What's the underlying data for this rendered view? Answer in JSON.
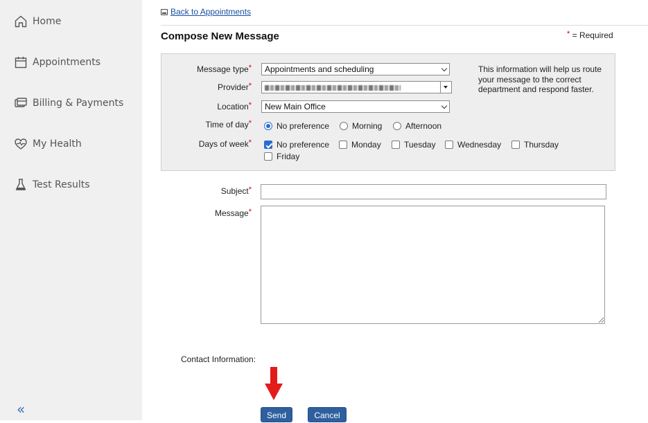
{
  "sidebar": {
    "items": [
      {
        "label": "Home",
        "icon": "home-icon"
      },
      {
        "label": "Appointments",
        "icon": "calendar-icon"
      },
      {
        "label": "Billing & Payments",
        "icon": "billing-icon"
      },
      {
        "label": "My Health",
        "icon": "heart-icon"
      },
      {
        "label": "Test Results",
        "icon": "flask-icon"
      }
    ],
    "collapse_label": "«"
  },
  "header": {
    "back_link": "Back to Appointments",
    "title": "Compose New Message",
    "required_star": "*",
    "required_text": "= Required"
  },
  "form": {
    "required_star": "*",
    "message_type": {
      "label": "Message type",
      "value": "Appointments and scheduling"
    },
    "provider": {
      "label": "Provider",
      "value_obscured": true
    },
    "location": {
      "label": "Location",
      "value": "New Main Office"
    },
    "info_text": "This information will help us route your message to the correct department and respond faster.",
    "time_of_day": {
      "label": "Time of day",
      "options": [
        "No preference",
        "Morning",
        "Afternoon"
      ],
      "selected": "No preference"
    },
    "days_of_week": {
      "label": "Days of week",
      "options": [
        "No preference",
        "Monday",
        "Tuesday",
        "Wednesday",
        "Thursday",
        "Friday"
      ],
      "checked": [
        "No preference"
      ]
    },
    "subject": {
      "label": "Subject",
      "value": ""
    },
    "message": {
      "label": "Message",
      "value": ""
    },
    "contact_label": "Contact Information:"
  },
  "actions": {
    "send": "Send",
    "cancel": "Cancel"
  },
  "colors": {
    "accent": "#2f5f9e",
    "required": "#cc0000",
    "link": "#1a4fa3",
    "annotation_arrow": "#e41b1b"
  }
}
